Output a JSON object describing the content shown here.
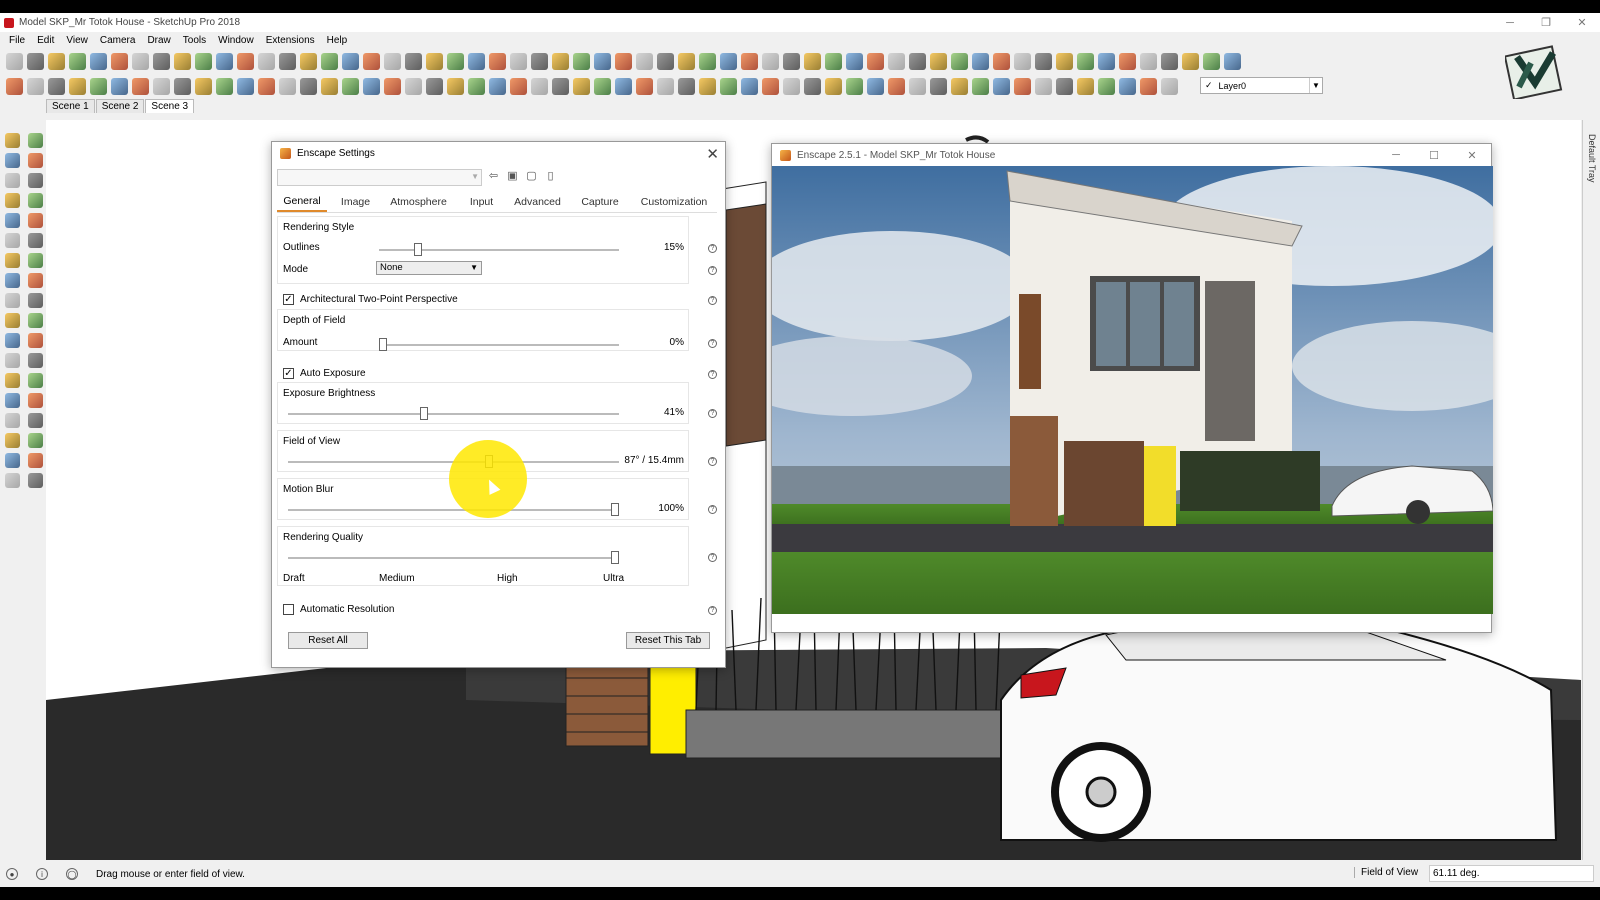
{
  "window": {
    "title": "Model SKP_Mr Totok House - SketchUp Pro 2018",
    "controls": [
      "─",
      "❐",
      "✕"
    ]
  },
  "menu": [
    "File",
    "Edit",
    "View",
    "Camera",
    "Draw",
    "Tools",
    "Window",
    "Extensions",
    "Help"
  ],
  "layer_select": {
    "checkmark": "✓",
    "value": "Layer0"
  },
  "scenes": [
    "Scene 1",
    "Scene 2",
    "Scene 3"
  ],
  "active_scene": "Scene 3",
  "tray_label": "Default Tray",
  "status": {
    "message": "Drag mouse or enter field of view.",
    "vcb_label": "Field of View",
    "vcb_value": "61.11 deg."
  },
  "enscape_settings": {
    "title": "Enscape Settings",
    "close": "✕",
    "preset_icons": [
      "⇦",
      "▣",
      "▢",
      "▯"
    ],
    "tabs": [
      "General",
      "Image",
      "Atmosphere",
      "Input",
      "Advanced",
      "Capture",
      "Customization"
    ],
    "active_tab": "General",
    "help_glyph": "?",
    "rendering_style": {
      "header": "Rendering Style",
      "outlines_label": "Outlines",
      "outlines_value": "15%",
      "outlines_level": 0.15,
      "mode_label": "Mode",
      "mode_value": "None"
    },
    "two_point": {
      "label": "Architectural Two-Point Perspective",
      "checked": true
    },
    "depth_of_field": {
      "header": "Depth of Field",
      "amount_label": "Amount",
      "amount_value": "0%",
      "amount_level": 0.0
    },
    "auto_exposure": {
      "label": "Auto Exposure",
      "checked": true
    },
    "exposure_brightness": {
      "header": "Exposure Brightness",
      "value": "41%",
      "level": 0.41
    },
    "field_of_view": {
      "header": "Field of View",
      "value": "87° / 15.4mm",
      "level": 0.61
    },
    "motion_blur": {
      "header": "Motion Blur",
      "value": "100%",
      "level": 1.0
    },
    "rendering_quality": {
      "header": "Rendering Quality",
      "levels": [
        "Draft",
        "Medium",
        "High",
        "Ultra"
      ],
      "level": 1.0
    },
    "automatic_resolution": {
      "label": "Automatic Resolution",
      "checked": false
    },
    "buttons": {
      "reset_all": "Reset All",
      "reset_tab": "Reset This Tab"
    }
  },
  "enscape_viewer": {
    "title": "Enscape 2.5.1 - Model SKP_Mr Totok House",
    "controls": [
      "─",
      "☐",
      "✕"
    ]
  },
  "colors": {
    "accent_tab": "#e08a2c",
    "highlight": "#ffe800"
  }
}
